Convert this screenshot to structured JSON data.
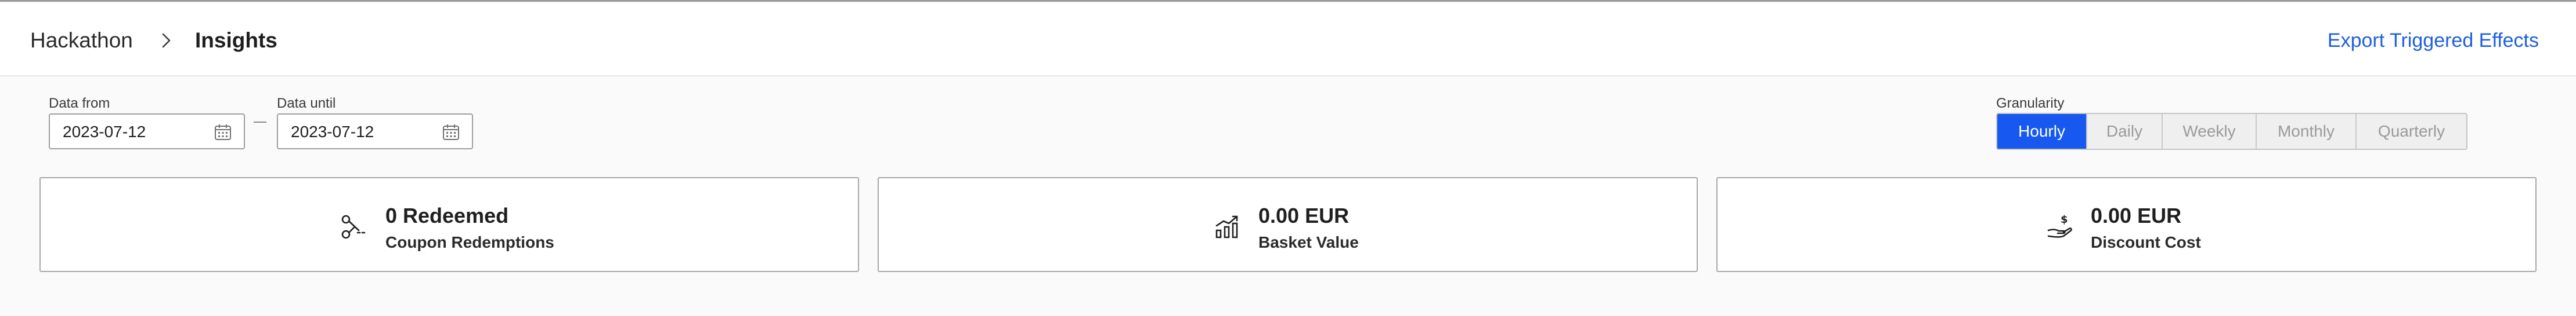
{
  "header": {
    "breadcrumb_root": "Hackathon",
    "breadcrumb_current": "Insights",
    "export_label": "Export Triggered Effects"
  },
  "filters": {
    "from_label": "Data from",
    "from_value": "2023-07-12",
    "until_label": "Data until",
    "until_value": "2023-07-12",
    "granularity_label": "Granularity",
    "granularity_options": [
      "Hourly",
      "Daily",
      "Weekly",
      "Monthly",
      "Quarterly"
    ],
    "granularity_selected": "Hourly"
  },
  "cards": [
    {
      "value": "0 Redeemed",
      "label": "Coupon Redemptions",
      "icon": "scissors-icon"
    },
    {
      "value": "0.00 EUR",
      "label": "Basket Value",
      "icon": "chart-growth-icon"
    },
    {
      "value": "0.00 EUR",
      "label": "Discount Cost",
      "icon": "hand-money-icon"
    }
  ],
  "colors": {
    "accent": "#1658f0",
    "link": "#1f5fe0"
  }
}
